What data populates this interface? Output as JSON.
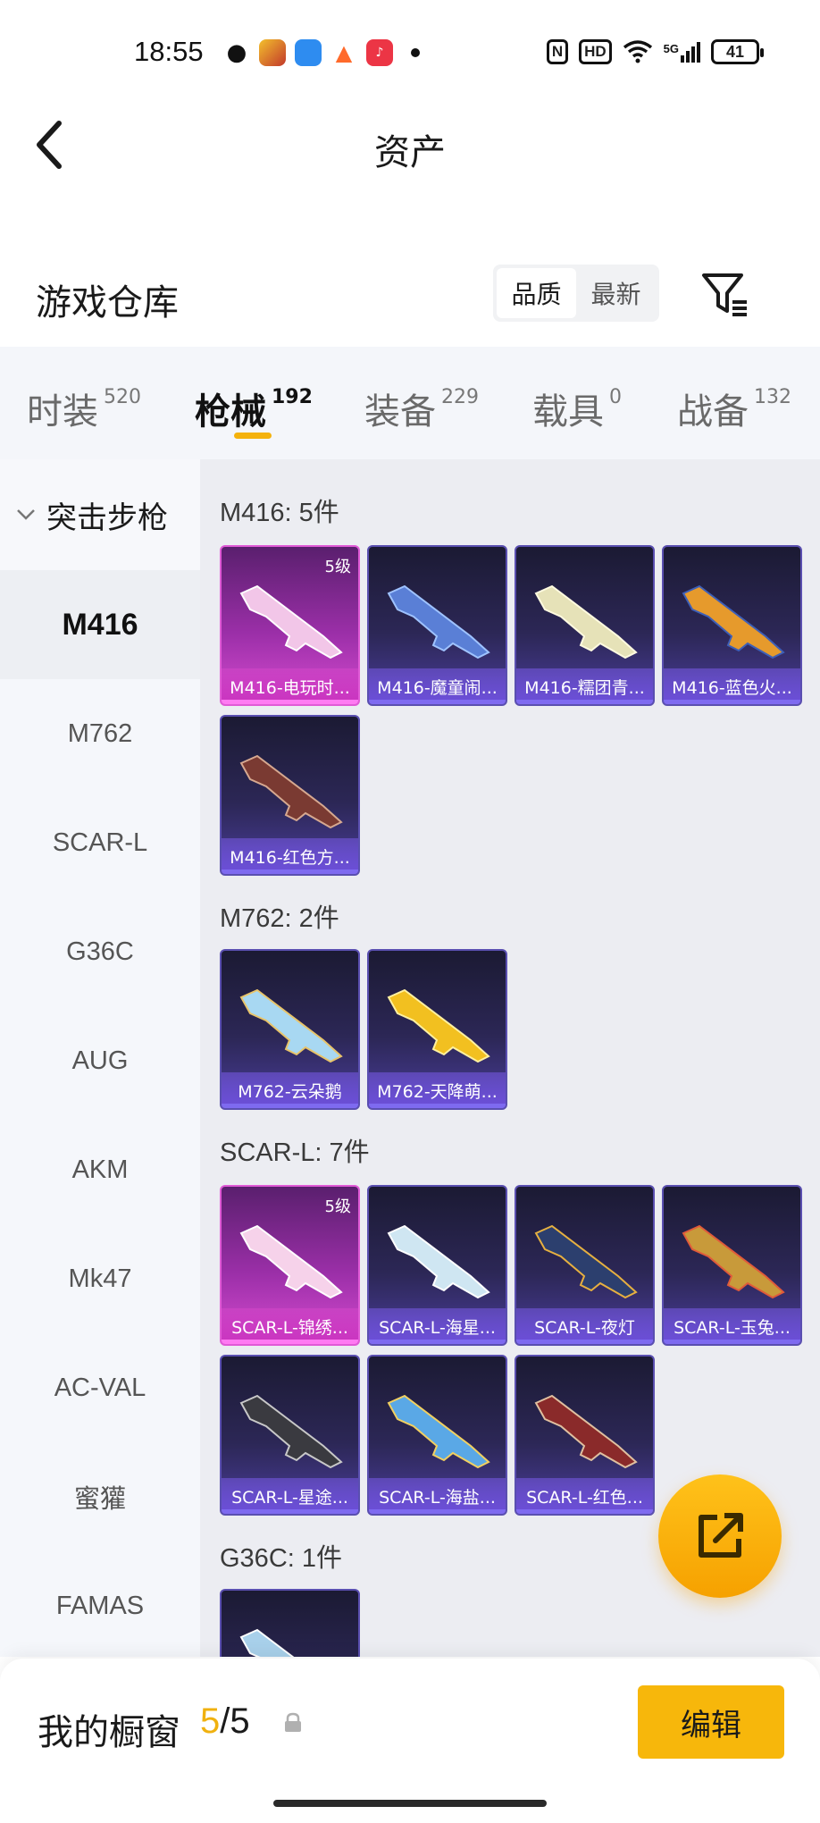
{
  "status_bar": {
    "time": "18:55",
    "battery": "41",
    "network": "5G",
    "hd": "HD",
    "nfc": "N"
  },
  "header": {
    "title": "资产"
  },
  "warehouse": {
    "title": "游戏仓库",
    "sort_options": [
      "品质",
      "最新"
    ],
    "active_sort": "品质"
  },
  "category_tabs": [
    {
      "label": "时装",
      "count": "520"
    },
    {
      "label": "枪械",
      "count": "192",
      "active": true
    },
    {
      "label": "装备",
      "count": "229"
    },
    {
      "label": "载具",
      "count": "0"
    },
    {
      "label": "战备",
      "count": "132"
    }
  ],
  "sidebar": {
    "group": "突击步枪",
    "items": [
      "M416",
      "M762",
      "SCAR-L",
      "G36C",
      "AUG",
      "AKM",
      "Mk47",
      "AC-VAL",
      "蜜獾",
      "FAMAS"
    ],
    "active": "M416"
  },
  "groups": [
    {
      "title": "M416: 5件",
      "items": [
        {
          "label": "M416-电玩时...",
          "level": "5级",
          "rarity": "pink"
        },
        {
          "label": "M416-魔童闹...",
          "rarity": "purple"
        },
        {
          "label": "M416-糯团青...",
          "rarity": "purple"
        },
        {
          "label": "M416-蓝色火...",
          "rarity": "purple"
        },
        {
          "label": "M416-红色方...",
          "rarity": "purple"
        }
      ]
    },
    {
      "title": "M762: 2件",
      "items": [
        {
          "label": "M762-云朵鹅",
          "rarity": "purple"
        },
        {
          "label": "M762-天降萌...",
          "rarity": "purple"
        }
      ]
    },
    {
      "title": "SCAR-L: 7件",
      "items": [
        {
          "label": "SCAR-L-锦绣...",
          "level": "5级",
          "rarity": "pink"
        },
        {
          "label": "SCAR-L-海星...",
          "rarity": "purple"
        },
        {
          "label": "SCAR-L-夜灯",
          "rarity": "purple"
        },
        {
          "label": "SCAR-L-玉兔...",
          "rarity": "purple"
        },
        {
          "label": "SCAR-L-星途...",
          "rarity": "purple"
        },
        {
          "label": "SCAR-L-海盐...",
          "rarity": "purple"
        },
        {
          "label": "SCAR-L-红色...",
          "rarity": "purple"
        }
      ]
    },
    {
      "title": "G36C: 1件",
      "items": [
        {
          "label": "",
          "rarity": "purple"
        }
      ]
    }
  ],
  "showcase": {
    "label": "我的橱窗",
    "current": "5",
    "separator": "/",
    "max": "5",
    "edit_label": "编辑"
  },
  "colors": {
    "accent": "#f7b70b",
    "rare_pink": "#d64bd0",
    "rare_purple": "#4a3d9a"
  }
}
